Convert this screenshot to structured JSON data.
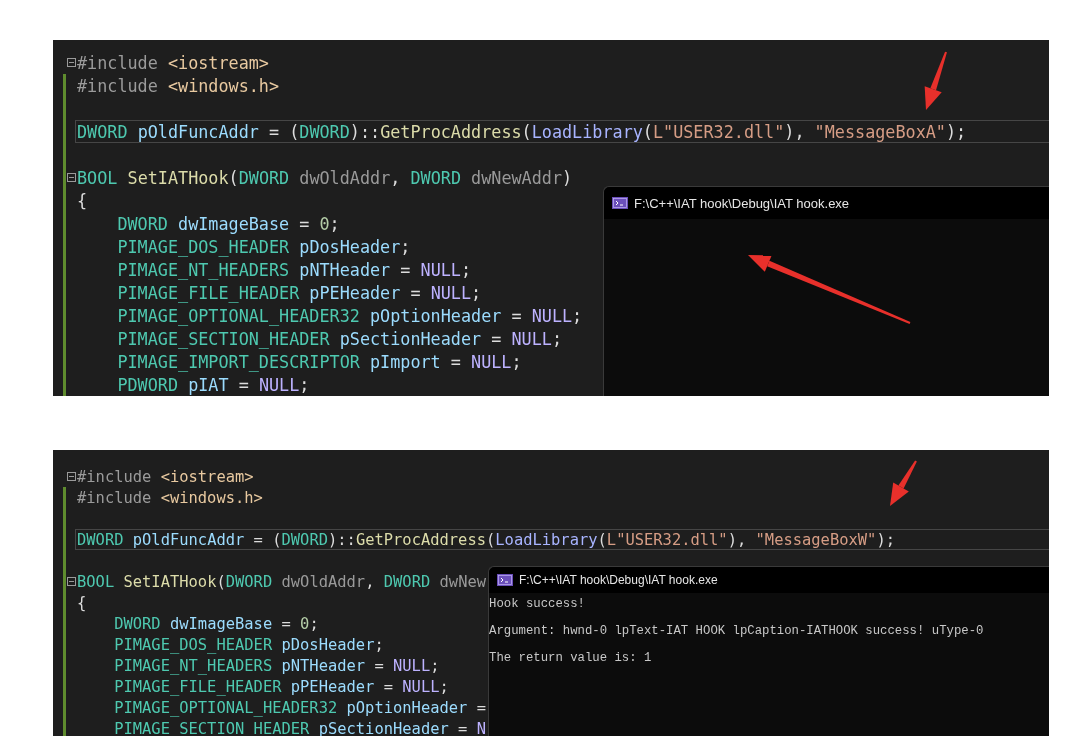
{
  "panels": [
    {
      "code_lines": [
        {
          "fold": true,
          "modified": false,
          "current": false,
          "tokens": [
            {
              "kind": "pre",
              "text": "#include"
            },
            {
              "kind": "path",
              "text": " <iostream>"
            }
          ]
        },
        {
          "fold": false,
          "modified": true,
          "current": false,
          "tokens": [
            {
              "kind": "pre",
              "text": "#include"
            },
            {
              "kind": "path",
              "text": " <windows.h>"
            }
          ]
        },
        {
          "fold": false,
          "modified": true,
          "current": false
        },
        {
          "fold": false,
          "modified": true,
          "current": true,
          "tokens": [
            {
              "kind": "type",
              "text": "DWORD"
            },
            {
              "kind": "var",
              "text": " pOldFuncAddr "
            },
            {
              "kind": "plain",
              "text": "= ("
            },
            {
              "kind": "type",
              "text": "DWORD"
            },
            {
              "kind": "plain",
              "text": ")::"
            },
            {
              "kind": "func",
              "text": "GetProcAddress"
            },
            {
              "kind": "plain",
              "text": "("
            },
            {
              "kind": "call",
              "text": "LoadLibrary"
            },
            {
              "kind": "plain",
              "text": "("
            },
            {
              "kind": "string",
              "text": "L\"USER32.dll\""
            },
            {
              "kind": "plain",
              "text": "), "
            },
            {
              "kind": "string",
              "text": "\"MessageBoxA\""
            },
            {
              "kind": "plain",
              "text": ");"
            }
          ]
        },
        {
          "fold": false,
          "modified": true,
          "current": false
        },
        {
          "fold": true,
          "modified": true,
          "current": false,
          "tokens": [
            {
              "kind": "type",
              "text": "BOOL"
            },
            {
              "kind": "func",
              "text": " SetIATHook"
            },
            {
              "kind": "plain",
              "text": "("
            },
            {
              "kind": "type",
              "text": "DWORD"
            },
            {
              "kind": "param",
              "text": " dwOldAddr"
            },
            {
              "kind": "plain",
              "text": ", "
            },
            {
              "kind": "type",
              "text": "DWORD"
            },
            {
              "kind": "param",
              "text": " dwNewAddr"
            },
            {
              "kind": "plain",
              "text": ")"
            }
          ]
        },
        {
          "fold": false,
          "modified": true,
          "current": false,
          "tokens": [
            {
              "kind": "plain",
              "text": "{"
            }
          ],
          "children": [
            {
              "fold": false,
              "modified": true,
              "current": false,
              "tokens": [
                {
                  "kind": "type",
                  "text": "DWORD"
                },
                {
                  "kind": "var",
                  "text": " dwImageBase "
                },
                {
                  "kind": "plain",
                  "text": "= "
                },
                {
                  "kind": "number",
                  "text": "0"
                },
                {
                  "kind": "plain",
                  "text": ";"
                }
              ]
            },
            {
              "fold": false,
              "modified": true,
              "current": false,
              "tokens": [
                {
                  "kind": "type",
                  "text": "PIMAGE_DOS_HEADER"
                },
                {
                  "kind": "var",
                  "text": " pDosHeader"
                },
                {
                  "kind": "plain",
                  "text": ";"
                }
              ]
            },
            {
              "fold": false,
              "modified": true,
              "current": false,
              "tokens": [
                {
                  "kind": "type",
                  "text": "PIMAGE_NT_HEADERS"
                },
                {
                  "kind": "var",
                  "text": " pNTHeader "
                },
                {
                  "kind": "plain",
                  "text": "= "
                },
                {
                  "kind": "macro",
                  "text": "NULL"
                },
                {
                  "kind": "plain",
                  "text": ";"
                }
              ]
            },
            {
              "fold": false,
              "modified": true,
              "current": false,
              "tokens": [
                {
                  "kind": "type",
                  "text": "PIMAGE_FILE_HEADER"
                },
                {
                  "kind": "var",
                  "text": " pPEHeader "
                },
                {
                  "kind": "plain",
                  "text": "= "
                },
                {
                  "kind": "macro",
                  "text": "NULL"
                },
                {
                  "kind": "plain",
                  "text": ";"
                }
              ]
            },
            {
              "fold": false,
              "modified": true,
              "current": false,
              "tokens": [
                {
                  "kind": "type",
                  "text": "PIMAGE_OPTIONAL_HEADER32"
                },
                {
                  "kind": "var",
                  "text": " pOptionHeader "
                },
                {
                  "kind": "plain",
                  "text": "= "
                },
                {
                  "kind": "macro",
                  "text": "NULL"
                },
                {
                  "kind": "plain",
                  "text": ";"
                }
              ]
            },
            {
              "fold": false,
              "modified": true,
              "current": false,
              "tokens": [
                {
                  "kind": "type",
                  "text": "PIMAGE_SECTION_HEADER"
                },
                {
                  "kind": "var",
                  "text": " pSectionHeader "
                },
                {
                  "kind": "plain",
                  "text": "= "
                },
                {
                  "kind": "macro",
                  "text": "NULL"
                },
                {
                  "kind": "plain",
                  "text": ";"
                }
              ]
            },
            {
              "fold": false,
              "modified": true,
              "current": false,
              "tokens": [
                {
                  "kind": "type",
                  "text": "PIMAGE_IMPORT_DESCRIPTOR"
                },
                {
                  "kind": "var",
                  "text": " pImport "
                },
                {
                  "kind": "plain",
                  "text": "= "
                },
                {
                  "kind": "macro",
                  "text": "NULL"
                },
                {
                  "kind": "plain",
                  "text": ";"
                }
              ]
            },
            {
              "fold": false,
              "modified": true,
              "current": false,
              "tokens": [
                {
                  "kind": "type",
                  "text": "PDWORD"
                },
                {
                  "kind": "var",
                  "text": " pIAT "
                },
                {
                  "kind": "plain",
                  "text": "= "
                },
                {
                  "kind": "macro",
                  "text": "NULL"
                },
                {
                  "kind": "plain",
                  "text": ";"
                }
              ]
            }
          ]
        }
      ],
      "console": {
        "title": "F:\\C++\\IAT hook\\Debug\\IAT hook.exe"
      }
    },
    {
      "code_lines": [
        {
          "fold": true,
          "modified": false,
          "current": false,
          "tokens": [
            {
              "kind": "pre",
              "text": "#include"
            },
            {
              "kind": "path",
              "text": " <iostream>"
            }
          ]
        },
        {
          "fold": false,
          "modified": true,
          "current": false,
          "tokens": [
            {
              "kind": "pre",
              "text": "#include"
            },
            {
              "kind": "path",
              "text": " <windows.h>"
            }
          ]
        },
        {
          "fold": false,
          "modified": true,
          "current": false
        },
        {
          "fold": false,
          "modified": true,
          "current": true,
          "tokens": [
            {
              "kind": "type",
              "text": "DWORD"
            },
            {
              "kind": "var",
              "text": " pOldFuncAddr "
            },
            {
              "kind": "plain",
              "text": "= ("
            },
            {
              "kind": "type",
              "text": "DWORD"
            },
            {
              "kind": "plain",
              "text": ")::"
            },
            {
              "kind": "func",
              "text": "GetProcAddress"
            },
            {
              "kind": "plain",
              "text": "("
            },
            {
              "kind": "call",
              "text": "LoadLibrary"
            },
            {
              "kind": "plain",
              "text": "("
            },
            {
              "kind": "string",
              "text": "L\"USER32.dll\""
            },
            {
              "kind": "plain",
              "text": "), "
            },
            {
              "kind": "string",
              "text": "\"MessageBoxW\""
            },
            {
              "kind": "plain",
              "text": ");"
            }
          ]
        },
        {
          "fold": false,
          "modified": true,
          "current": false
        },
        {
          "fold": true,
          "modified": true,
          "current": false,
          "tokens": [
            {
              "kind": "type",
              "text": "BOOL"
            },
            {
              "kind": "func",
              "text": " SetIATHook"
            },
            {
              "kind": "plain",
              "text": "("
            },
            {
              "kind": "type",
              "text": "DWORD"
            },
            {
              "kind": "param",
              "text": " dwOldAddr"
            },
            {
              "kind": "plain",
              "text": ", "
            },
            {
              "kind": "type",
              "text": "DWORD"
            },
            {
              "kind": "param",
              "text": " dwNew"
            }
          ]
        },
        {
          "fold": false,
          "modified": true,
          "current": false,
          "tokens": [
            {
              "kind": "plain",
              "text": "{"
            }
          ],
          "children": [
            {
              "fold": false,
              "modified": true,
              "current": false,
              "tokens": [
                {
                  "kind": "type",
                  "text": "DWORD"
                },
                {
                  "kind": "var",
                  "text": " dwImageBase "
                },
                {
                  "kind": "plain",
                  "text": "= "
                },
                {
                  "kind": "number",
                  "text": "0"
                },
                {
                  "kind": "plain",
                  "text": ";"
                }
              ]
            },
            {
              "fold": false,
              "modified": true,
              "current": false,
              "tokens": [
                {
                  "kind": "type",
                  "text": "PIMAGE_DOS_HEADER"
                },
                {
                  "kind": "var",
                  "text": " pDosHeader"
                },
                {
                  "kind": "plain",
                  "text": ";"
                }
              ]
            },
            {
              "fold": false,
              "modified": true,
              "current": false,
              "tokens": [
                {
                  "kind": "type",
                  "text": "PIMAGE_NT_HEADERS"
                },
                {
                  "kind": "var",
                  "text": " pNTHeader "
                },
                {
                  "kind": "plain",
                  "text": "= "
                },
                {
                  "kind": "macro",
                  "text": "NULL"
                },
                {
                  "kind": "plain",
                  "text": ";"
                }
              ]
            },
            {
              "fold": false,
              "modified": true,
              "current": false,
              "tokens": [
                {
                  "kind": "type",
                  "text": "PIMAGE_FILE_HEADER"
                },
                {
                  "kind": "var",
                  "text": " pPEHeader "
                },
                {
                  "kind": "plain",
                  "text": "= "
                },
                {
                  "kind": "macro",
                  "text": "NULL"
                },
                {
                  "kind": "plain",
                  "text": ";"
                }
              ]
            },
            {
              "fold": false,
              "modified": true,
              "current": false,
              "tokens": [
                {
                  "kind": "type",
                  "text": "PIMAGE_OPTIONAL_HEADER32"
                },
                {
                  "kind": "var",
                  "text": " pOptionHeader "
                },
                {
                  "kind": "plain",
                  "text": "="
                }
              ]
            },
            {
              "fold": false,
              "modified": true,
              "current": false,
              "tokens": [
                {
                  "kind": "type",
                  "text": "PIMAGE_SECTION_HEADER"
                },
                {
                  "kind": "var",
                  "text": " pSectionHeader "
                },
                {
                  "kind": "plain",
                  "text": "= "
                },
                {
                  "kind": "macro",
                  "text": "N"
                }
              ]
            }
          ]
        }
      ],
      "console": {
        "title": "F:\\C++\\IAT hook\\Debug\\IAT hook.exe",
        "output": [
          "Hook success!",
          "Argument: hwnd-0 lpText-IAT HOOK lpCaption-IATHOOK success! uType-0",
          "The return value is: 1"
        ]
      }
    }
  ]
}
